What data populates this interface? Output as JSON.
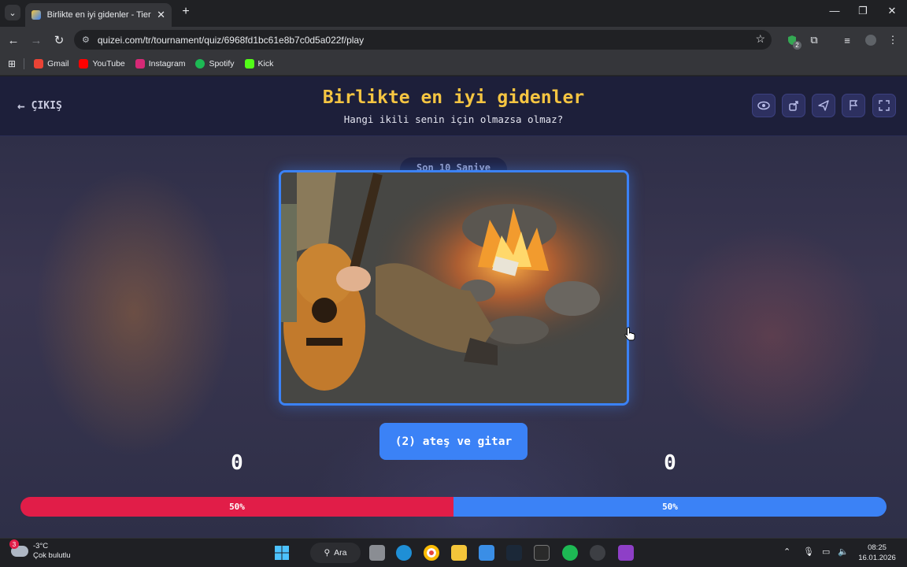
{
  "browser": {
    "tab_title": "Birlikte en iyi gidenler - Tier List",
    "url": "quizei.com/tr/tournament/quiz/6968fd1bc61e8b7c0d5a022f/play",
    "extension_badge": "2",
    "bookmarks": [
      {
        "label": "Gmail",
        "color": "#ea4335"
      },
      {
        "label": "YouTube",
        "color": "#ff0000"
      },
      {
        "label": "Instagram",
        "color": "#d62976"
      },
      {
        "label": "Spotify",
        "color": "#1db954"
      },
      {
        "label": "Kick",
        "color": "#53fc18"
      }
    ]
  },
  "page": {
    "exit_label": "ÇIKIŞ",
    "title": "Birlikte en iyi gidenler",
    "subtitle": "Hangi ikili senin için olmazsa olmaz?",
    "timer_label": "Son 10 Saniye",
    "choice_label": "(2) ateş ve gitar",
    "score_left": "0",
    "score_right": "0",
    "vote_left_label": "50%",
    "vote_right_label": "50%",
    "vote_left_fraction": 0.5,
    "accent": "#3b82f6",
    "title_color": "#f5c542",
    "left_color": "#e11d48",
    "header_icons": [
      "eye-icon",
      "share-icon",
      "send-icon",
      "flag-icon",
      "fullscreen-icon"
    ]
  },
  "taskbar": {
    "weather_badge": "3",
    "temperature": "-3°C",
    "condition": "Çok bulutlu",
    "search_label": "Ara",
    "time": "08:25",
    "date": "16.01.2026"
  }
}
